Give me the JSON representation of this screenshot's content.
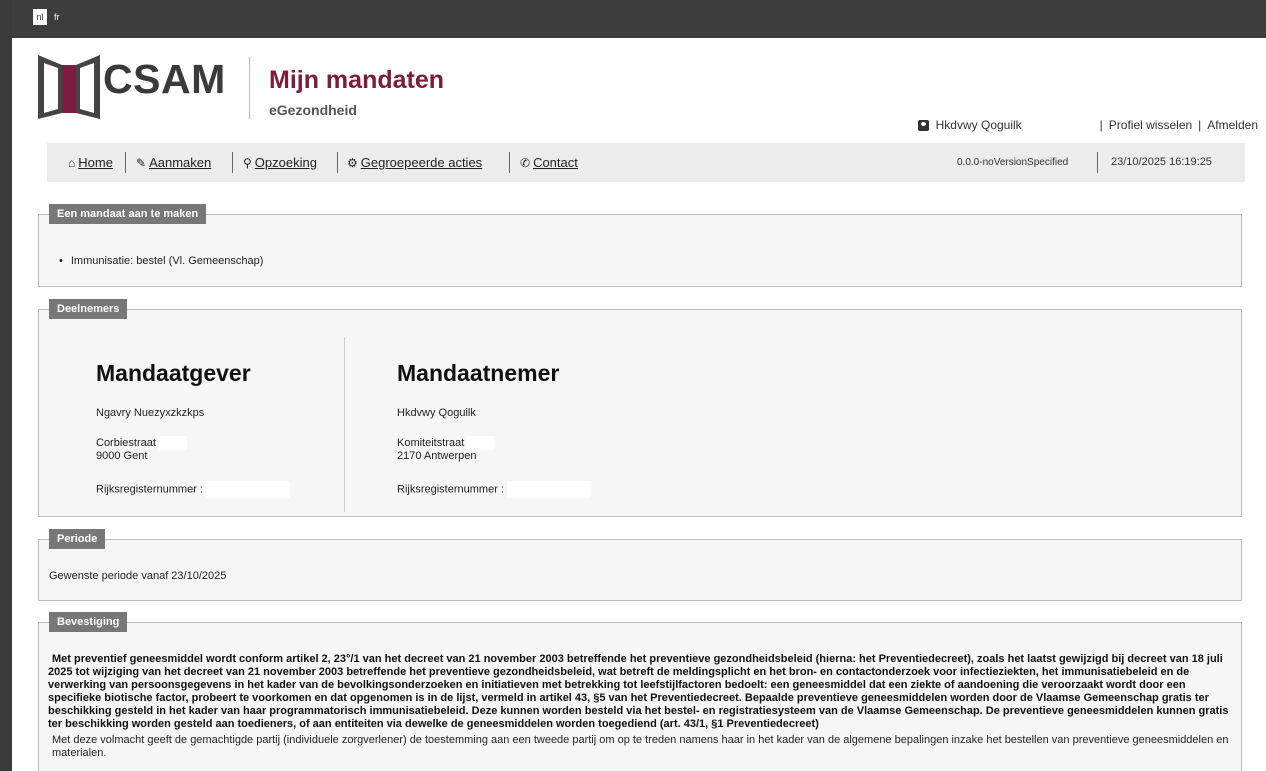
{
  "languages": {
    "nl": "nl",
    "fr": "fr"
  },
  "branding": {
    "logo_text": "CSAM",
    "app_title": "Mijn mandaten",
    "app_subtitle": "eGezondheid",
    "logo_color": "#7b1d3f"
  },
  "user": {
    "name": "Hkdvwy Qoguilk",
    "switch_profile": "Profiel wisselen",
    "logout": "Afmelden"
  },
  "nav": {
    "items": [
      {
        "label": "Home",
        "icon": "home-icon"
      },
      {
        "label": "Aanmaken",
        "icon": "pencil-icon"
      },
      {
        "label": "Opzoeking",
        "icon": "search-icon"
      },
      {
        "label": "Gegroepeerde acties",
        "icon": "group-icon"
      },
      {
        "label": "Contact",
        "icon": "phone-icon"
      }
    ],
    "version": "0.0.0-noVersionSpecified",
    "datetime": "23/10/2025 16:19:25"
  },
  "mandate_section": {
    "legend": "Een mandaat aan te maken",
    "items": [
      "Immunisatie: bestel (Vl. Gemeenschap)"
    ]
  },
  "participants": {
    "legend": "Deelnemers",
    "giver": {
      "title": "Mandaatgever",
      "name": "Ngavry Nuezyxzkzkps",
      "street": "Corbiestraat",
      "city": "9000 Gent",
      "rrn_label": "Rijksregisternummer :"
    },
    "receiver": {
      "title": "Mandaatnemer",
      "name": "Hkdvwy Qoguilk",
      "street": "Komiteitstraat",
      "city": "2170 Antwerpen",
      "rrn_label": "Rijksregisternummer :"
    }
  },
  "period": {
    "legend": "Periode",
    "text": "Gewenste periode vanaf 23/10/2025"
  },
  "confirmation": {
    "legend": "Bevestiging",
    "bold_text": "Met preventief geneesmiddel wordt conform artikel 2, 23°/1 van het decreet van 21 november 2003 betreffende het preventieve gezondheidsbeleid (hierna: het Preventiedecreet), zoals het laatst gewijzigd bij decreet van 18 juli 2025 tot wijziging van het decreet van 21 november 2003 betreffende het preventieve gezondheidsbeleid, wat betreft de meldingsplicht en het bron- en contactonderzoek voor infectieziekten, het immunisatiebeleid en de verwerking van persoonsgegevens in het kader van de bevolkingsonderzoeken en initiatieven met betrekking tot leefstijlfactoren bedoelt: een geneesmiddel dat een ziekte of aandoening die veroorzaakt wordt door een specifieke biotische factor, probeert te voorkomen en dat opgenomen is in de lijst, vermeld in artikel 43, §5 van het Preventiedecreet. Bepaalde preventieve geneesmiddelen worden door de Vlaamse Gemeenschap gratis ter beschikking gesteld in het kader van haar programmatorisch immunisatiebeleid. Deze kunnen worden besteld via het bestel- en registratiesysteem van de Vlaamse Gemeenschap. De preventieve geneesmiddelen kunnen gratis ter beschikking worden gesteld aan toedieners, of aan entiteiten via dewelke de geneesmiddelen worden toegediend (art. 43/1, §1 Preventiedecreet)",
    "normal_text": "Met deze volmacht geeft de gemachtigde partij (individuele zorgverlener) de toestemming aan een tweede partij om op te treden namens haar in het kader van de algemene bepalingen inzake het bestellen van preventieve geneesmiddelen en materialen."
  }
}
